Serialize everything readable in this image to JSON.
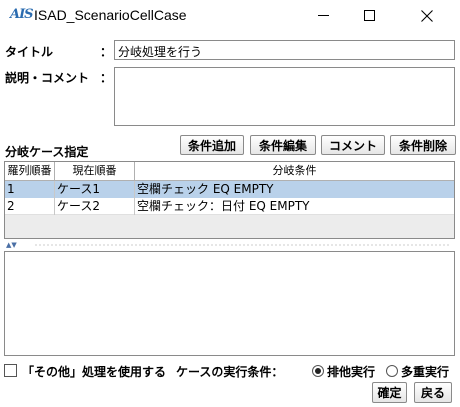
{
  "window": {
    "app_icon_text": "AIS",
    "title": "ISAD_ScenarioCellCase",
    "minimize_glyph": "",
    "maximize_glyph": "",
    "close_glyph": "✕"
  },
  "form": {
    "title_label": "タイトル",
    "title_colon": "：",
    "title_value": "分岐処理を行う",
    "comment_label": "説明・コメント",
    "comment_colon": "：",
    "comment_value": ""
  },
  "cases": {
    "section_label": "分岐ケース指定",
    "buttons": {
      "add": "条件追加",
      "edit": "条件編集",
      "comment": "コメント",
      "delete": "条件削除"
    },
    "columns": [
      "羅列順番",
      "現在順番",
      "分岐条件"
    ],
    "rows": [
      {
        "listing_order": "1",
        "current_order": "ケース1",
        "condition": "空欄チェック EQ EMPTY",
        "selected": true
      },
      {
        "listing_order": "2",
        "current_order": "ケース2",
        "condition": "空欄チェック：日付 EQ EMPTY",
        "selected": false
      }
    ],
    "splitter_arrows": "▲▼"
  },
  "options": {
    "other_checkbox_label": "「その他」処理を使用する",
    "other_checked": false,
    "exec_condition_label": "ケースの実行条件：",
    "radio_exclusive": "排他実行",
    "radio_multiple": "多重実行",
    "selected_mode": "排他実行"
  },
  "footer": {
    "ok": "確定",
    "back": "戻る"
  }
}
